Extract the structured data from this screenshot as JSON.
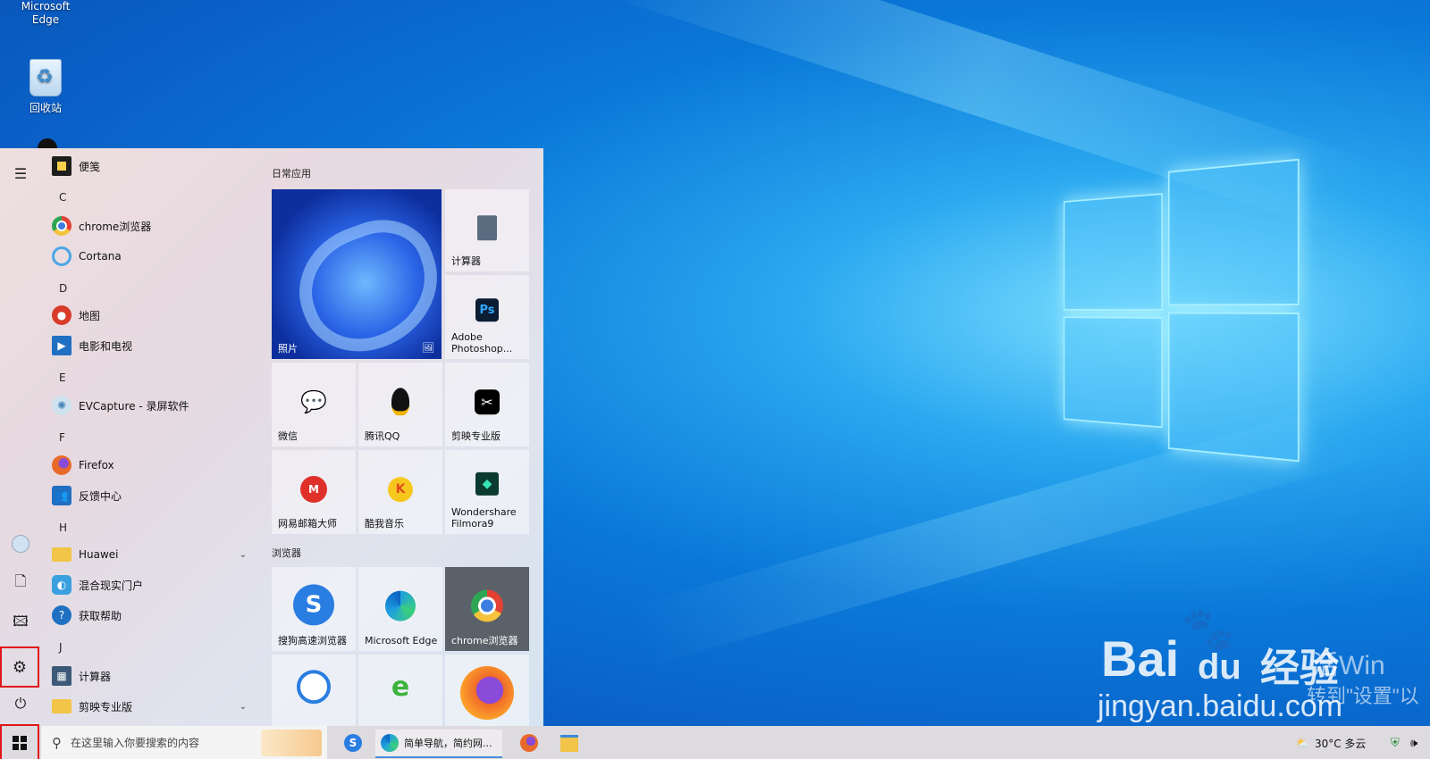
{
  "desktop": {
    "icons": [
      {
        "label": "Microsoft\nEdge"
      },
      {
        "label": "回收站"
      }
    ],
    "watermark": {
      "brand": "Bai",
      "brand2": "du",
      "brand_cn": "经验",
      "url": "jingyan.baidu.com",
      "overlay1": "活Win",
      "overlay2": "转到\"设置\"以"
    }
  },
  "start_menu": {
    "rail": [
      "menu-icon",
      "user-icon",
      "document-icon",
      "pictures-icon",
      "settings-icon",
      "power-icon"
    ],
    "apps": [
      {
        "type": "app",
        "label": "便笺",
        "icon": "sticky-notes-icon",
        "color": "#1d1d1d"
      },
      {
        "type": "letter",
        "label": "C"
      },
      {
        "type": "app",
        "label": "chrome浏览器",
        "icon": "chrome-icon",
        "color": "#e34133"
      },
      {
        "type": "app",
        "label": "Cortana",
        "icon": "cortana-icon",
        "color": "#4aa6e8"
      },
      {
        "type": "letter",
        "label": "D"
      },
      {
        "type": "app",
        "label": "地图",
        "icon": "maps-icon",
        "color": "#d83b2a"
      },
      {
        "type": "app",
        "label": "电影和电视",
        "icon": "movies-icon",
        "color": "#1f6fc2"
      },
      {
        "type": "letter",
        "label": "E"
      },
      {
        "type": "app",
        "label": "EVCapture - 录屏软件",
        "icon": "evcapture-icon",
        "color": "#8fb8d8"
      },
      {
        "type": "letter",
        "label": "F"
      },
      {
        "type": "app",
        "label": "Firefox",
        "icon": "firefox-icon",
        "color": "#e86a2a"
      },
      {
        "type": "app",
        "label": "反馈中心",
        "icon": "feedback-icon",
        "color": "#1f6fc2"
      },
      {
        "type": "letter",
        "label": "H"
      },
      {
        "type": "folder",
        "label": "Huawei",
        "icon": "folder-icon",
        "color": "#f2c447",
        "chevron": "⌄"
      },
      {
        "type": "app",
        "label": "混合现实门户",
        "icon": "mixed-reality-icon",
        "color": "#3aa0e0"
      },
      {
        "type": "app",
        "label": "获取帮助",
        "icon": "help-icon",
        "color": "#1f6fc2"
      },
      {
        "type": "letter",
        "label": "J"
      },
      {
        "type": "app",
        "label": "计算器",
        "icon": "calculator-icon",
        "color": "#3c5a78"
      },
      {
        "type": "folder",
        "label": "剪映专业版",
        "icon": "folder-icon",
        "color": "#f2c447",
        "chevron": "⌄"
      }
    ],
    "groups": [
      {
        "label": "日常应用"
      },
      {
        "label": "浏览器"
      }
    ],
    "tiles": {
      "photos": "照片",
      "calculator": "计算器",
      "photoshop": "Adobe\nPhotoshop...",
      "wechat": "微信",
      "qq": "腾讯QQ",
      "capcut": "剪映专业版",
      "mailmaster": "网易邮箱大师",
      "kuwo": "酷我音乐",
      "filmora": "Wondershare\nFilmora9",
      "sogou": "搜狗高速浏览器",
      "edge": "Microsoft Edge",
      "chrome": "chrome浏览器",
      "ie1": "",
      "ie2": "",
      "firefox": ""
    }
  },
  "taskbar": {
    "search_placeholder": "在这里输入你要搜索的内容",
    "active_window": "简单导航，简约网...",
    "weather": "30°C  多云",
    "icons": [
      "windows-start-icon",
      "search-icon",
      "sogou-icon",
      "edge-icon",
      "firefox-icon",
      "file-explorer-icon"
    ]
  }
}
